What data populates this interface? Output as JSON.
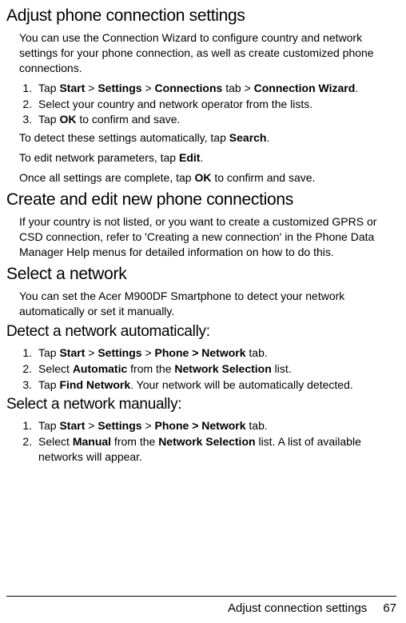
{
  "section1": {
    "heading": "Adjust phone connection settings",
    "intro": "You can use the Connection Wizard to configure country and network settings for your phone connection, as well as create customized phone connections.",
    "step1_pre": "Tap ",
    "step1_b1": "Start",
    "step1_gt1": " > ",
    "step1_b2": "Settings",
    "step1_gt2": " > ",
    "step1_b3": "Connections",
    "step1_mid": " tab > ",
    "step1_b4": "Connection Wizard",
    "step1_post": ".",
    "step2": "Select your country and network operator from the lists.",
    "step3_pre": "Tap ",
    "step3_b": "OK",
    "step3_post": " to confirm and save.",
    "detect_pre": "To detect these settings automatically, tap ",
    "detect_b": "Search",
    "detect_post": ".",
    "edit_pre": "To edit network parameters, tap ",
    "edit_b": "Edit",
    "edit_post": ".",
    "complete_pre": "Once all settings are complete, tap ",
    "complete_b": "OK",
    "complete_post": " to confirm and save."
  },
  "section2": {
    "heading": "Create and edit new phone connections",
    "body": "If your country is not listed, or you want to create a customized GPRS or CSD connection, refer to 'Creating a new connection' in the Phone Data Manager Help menus for detailed informa­tion on how to do this."
  },
  "section3": {
    "heading": "Select a network",
    "body": "You can set the Acer M900DF Smartphone to detect your net­work automatically or set it manually."
  },
  "section4": {
    "heading": "Detect a network automatically:",
    "step1_pre": "Tap ",
    "step1_b1": "Start",
    "step1_gt1": " > ",
    "step1_b2": "Settings",
    "step1_gt2": " > ",
    "step1_b3": "Phone > Network",
    "step1_post": " tab.",
    "step2_pre": "Select ",
    "step2_b1": "Automatic",
    "step2_mid": " from the ",
    "step2_b2": "Network Selection",
    "step2_post": " list.",
    "step3_pre": "Tap ",
    "step3_b": "Find Network",
    "step3_post": ". Your network will be automatically detected."
  },
  "section5": {
    "heading": "Select a network manually:",
    "step1_pre": "Tap ",
    "step1_b1": "Start",
    "step1_gt1": " > ",
    "step1_b2": "Settings",
    "step1_gt2": " > ",
    "step1_b3": "Phone > Network",
    "step1_post": " tab.",
    "step2_pre": "Select ",
    "step2_b1": "Manual",
    "step2_mid": " from the ",
    "step2_b2": "Network Selection",
    "step2_post": " list. A list of available networks will appear."
  },
  "footer": {
    "title": "Adjust connection settings",
    "page": "67"
  }
}
